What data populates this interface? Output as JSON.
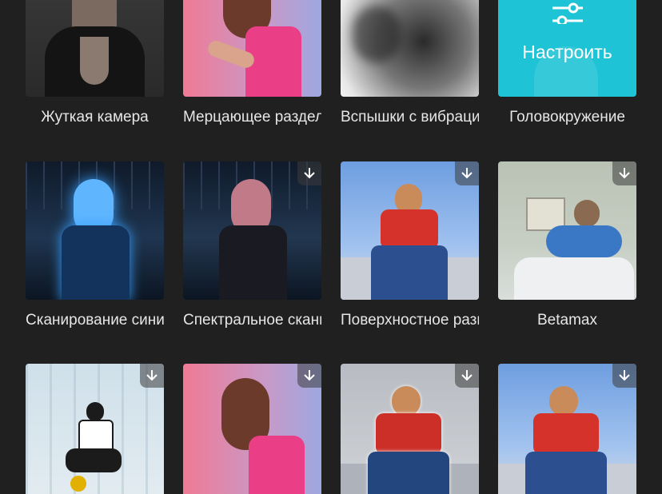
{
  "effects": [
    {
      "label": "Жуткая камера",
      "downloadable": false
    },
    {
      "label": "Мерцающее разделение",
      "downloadable": false
    },
    {
      "label": "Вспышки с вибрацией",
      "downloadable": false
    },
    {
      "label": "Головокружение",
      "downloadable": false,
      "adjust_label": "Настроить",
      "icon": "sliders-icon",
      "selected": true
    },
    {
      "label": "Сканирование синим",
      "downloadable": false
    },
    {
      "label": "Спектральное сканирование",
      "downloadable": true,
      "icon": "download-icon"
    },
    {
      "label": "Поверхностное размытие",
      "downloadable": true,
      "icon": "download-icon"
    },
    {
      "label": "Betamax",
      "downloadable": true,
      "icon": "download-icon"
    },
    {
      "label": "",
      "downloadable": true,
      "icon": "download-icon"
    },
    {
      "label": "",
      "downloadable": true,
      "icon": "download-icon"
    },
    {
      "label": "",
      "downloadable": true,
      "icon": "download-icon"
    },
    {
      "label": "",
      "downloadable": true,
      "icon": "download-icon"
    }
  ],
  "colors": {
    "background": "#202020",
    "accent": "#1fc3d6",
    "label": "#e6e6e6"
  }
}
